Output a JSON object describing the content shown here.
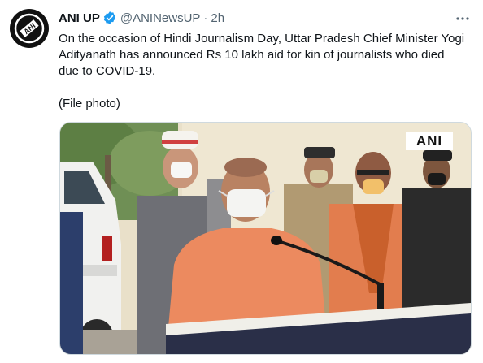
{
  "tweet": {
    "author_name": "ANI UP",
    "handle": "@ANINewsUP",
    "separator": "·",
    "time": "2h",
    "text_main": "On the occasion of Hindi Journalism Day, Uttar Pradesh Chief Minister Yogi Adityanath has announced Rs 10 lakh aid for kin of journalists who died due to COVID-19.",
    "text_note": "(File photo)",
    "media_watermark": "ANI",
    "avatar_logo_text": "ANI"
  },
  "colors": {
    "verified": "#1d9bf0",
    "secondary_text": "#536471",
    "saffron": "#ec8a5f"
  },
  "icons": {
    "verified": "verified-badge-icon",
    "more": "more-dots-icon"
  }
}
